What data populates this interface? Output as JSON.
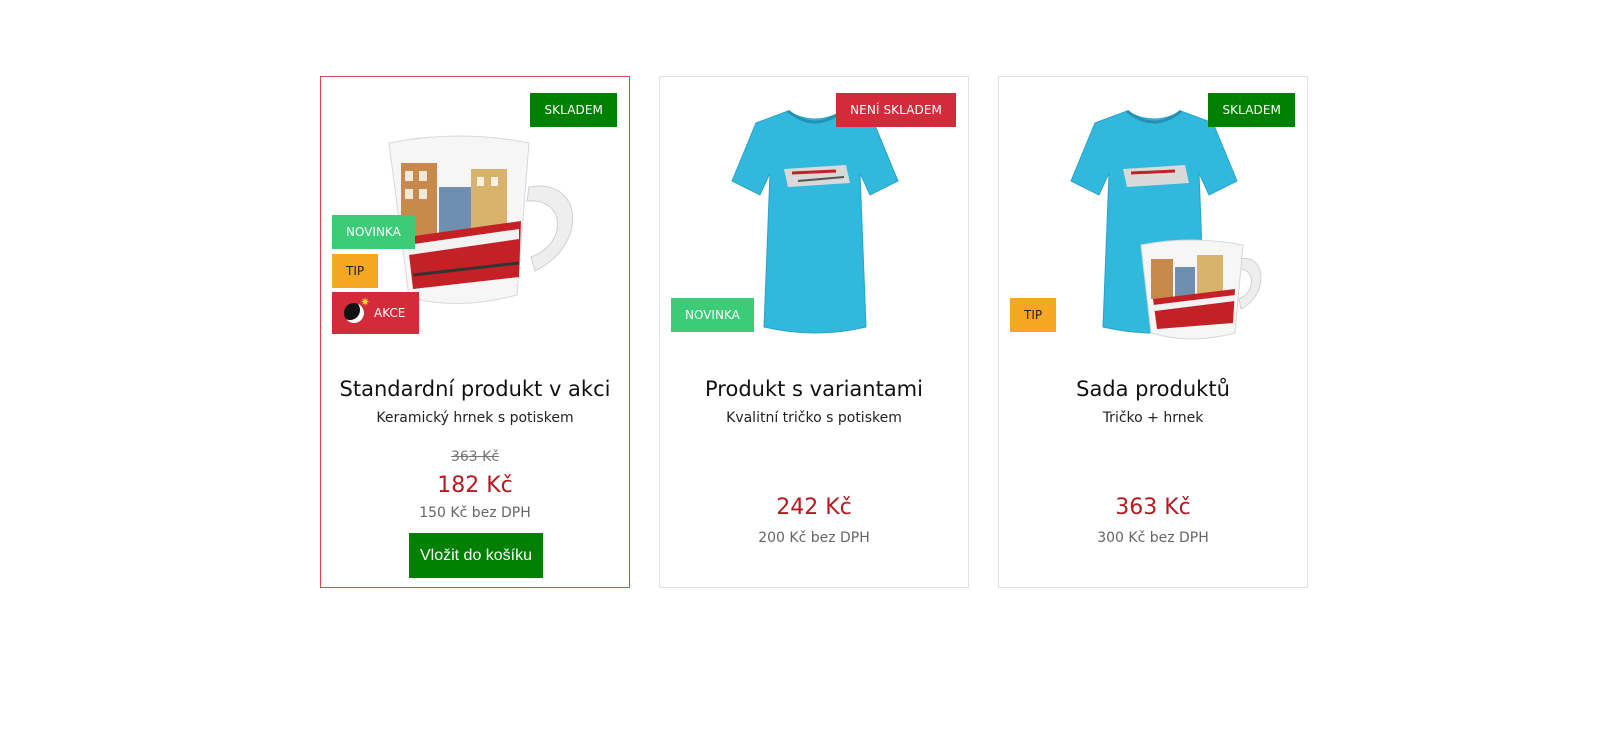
{
  "products": [
    {
      "stock_label": "SKLADEM",
      "flags": {
        "new": "NOVINKA",
        "tip": "TIP",
        "sale": "AKCE"
      },
      "title": "Standardní produkt v akci",
      "subtitle": "Keramický hrnek s potiskem",
      "old_price": "363 Kč",
      "price": "182 Kč",
      "net_price": "150 Kč bez DPH",
      "cart_button": "Vložit do košíku"
    },
    {
      "stock_label": "NENÍ SKLADEM",
      "flags": {
        "new": "NOVINKA"
      },
      "title": "Produkt s variantami",
      "subtitle": "Kvalitní tričko s potiskem",
      "price": "242 Kč",
      "net_price": "200 Kč bez DPH"
    },
    {
      "stock_label": "SKLADEM",
      "flags": {
        "tip": "TIP"
      },
      "title": "Sada produktů",
      "subtitle": "Tričko + hrnek",
      "price": "363 Kč",
      "net_price": "300 Kč bez DPH"
    }
  ],
  "colors": {
    "in_stock": "#008000",
    "out_of_stock": "#d42b3a",
    "new_flag": "#3ccb77",
    "tip_flag": "#f5a623",
    "price": "#b51a1f",
    "active_border": "#e0484f"
  },
  "icons": {
    "sale": "bomb-icon"
  }
}
